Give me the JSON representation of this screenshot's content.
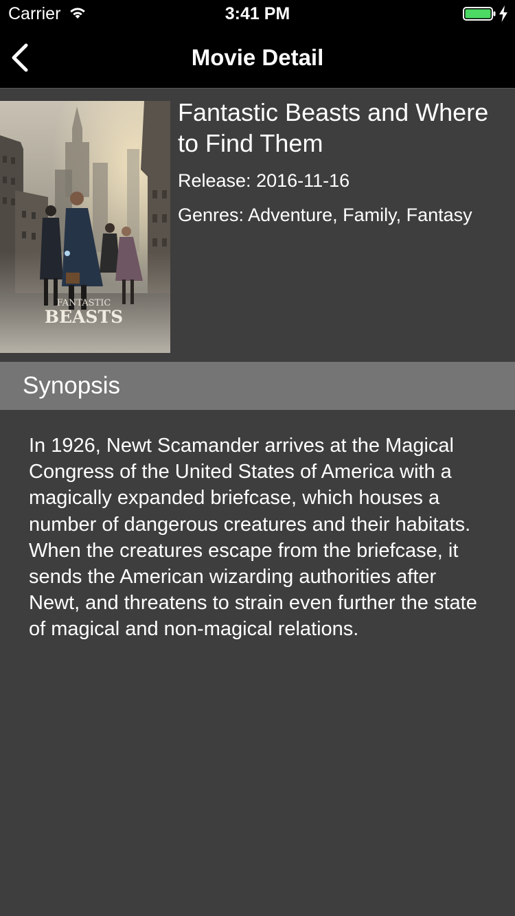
{
  "status_bar": {
    "carrier": "Carrier",
    "time": "3:41 PM",
    "icons": [
      "wifi-icon",
      "battery-icon",
      "charging-bolt-icon"
    ]
  },
  "nav": {
    "title": "Movie Detail",
    "back_icon": "chevron-left-icon"
  },
  "movie": {
    "title": "Fantastic Beasts and Where to Find Them",
    "release": "Release: 2016-11-16",
    "genres": "Genres: Adventure, Family, Fantasy",
    "poster_text": "FANTASTIC BEASTS"
  },
  "synopsis": {
    "heading": "Synopsis",
    "text": "In 1926, Newt Scamander arrives at the Magical Congress of the United States of America with a magically expanded briefcase, which houses a number of dangerous creatures and their habitats. When the creatures escape from the briefcase, it sends the American wizarding authorities after Newt, and threatens to strain even further the state of magical and non-magical relations."
  },
  "colors": {
    "background": "#3e3e3e",
    "bar": "#000000",
    "section_header": "#757575",
    "battery": "#4cd964"
  }
}
